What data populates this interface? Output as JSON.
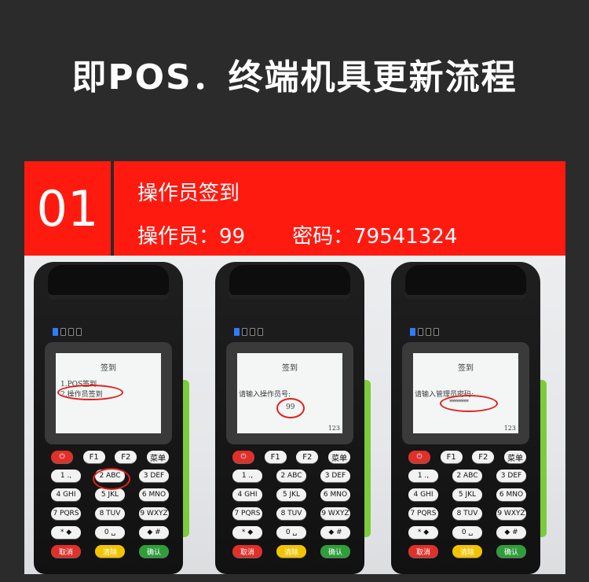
{
  "header": {
    "title": "即POS．终端机具更新流程"
  },
  "step": {
    "number": "01",
    "title": "操作员签到",
    "operator_label": "操作员：99",
    "password_label": "密码：79541324"
  },
  "screens": [
    {
      "title": "签到",
      "line1": "1.POS签到",
      "line2": "2.操作员签到",
      "prompt": "",
      "value": "",
      "mode": ""
    },
    {
      "title": "签到",
      "line1": "",
      "line2": "",
      "prompt": "请输入操作员号:",
      "value": "99",
      "mode": "123"
    },
    {
      "title": "签到",
      "line1": "",
      "line2": "",
      "prompt": "请输入管理员密码:",
      "value": "********",
      "mode": "123"
    }
  ],
  "keypad": {
    "row0": [
      "⏻",
      "F1",
      "F2",
      "菜单"
    ],
    "row1": [
      "1 .,",
      "2 ABC",
      "3 DEF"
    ],
    "row2": [
      "4 GHI",
      "5 JKL",
      "6 MNO"
    ],
    "row3": [
      "7 PQRS",
      "8 TUV",
      "9 WXYZ"
    ],
    "row4": [
      "* ◆",
      "0 ␣",
      "◆ #"
    ],
    "row5": [
      "取消",
      "清除",
      "确认"
    ]
  }
}
